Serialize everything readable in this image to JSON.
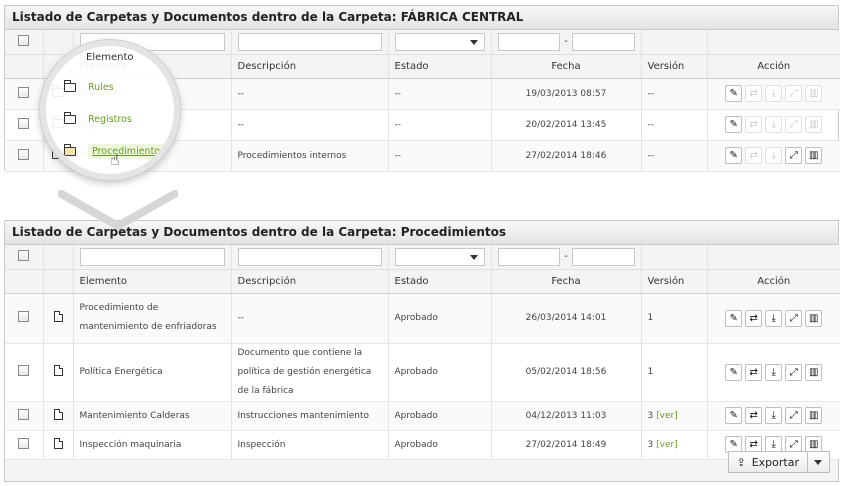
{
  "panel1": {
    "title": "Listado de Carpetas y Documentos dentro de la Carpeta: FÁBRICA CENTRAL",
    "columns": [
      "Elemento",
      "Descripción",
      "Estado",
      "Fecha",
      "Versión",
      "Acción"
    ],
    "rows": [
      {
        "name": "Rules",
        "description": "--",
        "status": "--",
        "date": "19/03/2013 08:57",
        "version": "--"
      },
      {
        "name": "Registros",
        "description": "--",
        "status": "--",
        "date": "20/02/2014 13:45",
        "version": "--"
      },
      {
        "name": "Procedimientos",
        "description": "Procedimientos internos",
        "status": "--",
        "date": "27/02/2014 18:46",
        "version": "--"
      }
    ]
  },
  "panel2": {
    "title": "Listado de Carpetas y Documentos dentro de la Carpeta: Procedimientos",
    "columns": [
      "Elemento",
      "Descripción",
      "Estado",
      "Fecha",
      "Versión",
      "Acción"
    ],
    "rows": [
      {
        "name": "Procedimiento de mantenimiento de enfriadoras",
        "description": "--",
        "status": "Aprobado",
        "date": "26/03/2014 14:01",
        "version": "1",
        "version_link": ""
      },
      {
        "name": "Política Energética",
        "description": "Documento que contiene la política de gestión energética de la fábrica",
        "status": "Aprobado",
        "date": "05/02/2014 18:56",
        "version": "1",
        "version_link": ""
      },
      {
        "name": "Mantenimiento Calderas",
        "description": "Instrucciones mantenimiento",
        "status": "Aprobado",
        "date": "04/12/2013 11:03",
        "version": "3",
        "version_link": "[ver]"
      },
      {
        "name": "Inspección maquinaria",
        "description": "Inspección",
        "status": "Aprobado",
        "date": "27/02/2014 18:49",
        "version": "3",
        "version_link": "[ver]"
      }
    ]
  },
  "date_separator": "-",
  "export": {
    "label": "Exportar"
  },
  "icons": {
    "edit": "edit-icon",
    "move": "move-icon",
    "download": "download-icon",
    "link": "link-icon",
    "delete": "trash-icon"
  },
  "colors": {
    "link": "#6a9a1f",
    "header_bg": "#f4f4f4"
  }
}
